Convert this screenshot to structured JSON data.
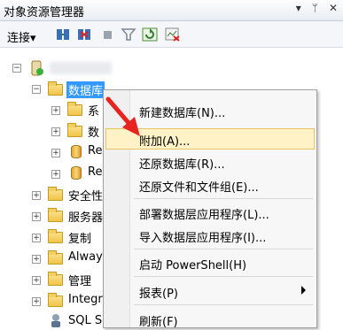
{
  "window": {
    "title": "对象资源管理器",
    "pin_glyph": "▾ ᛘ ✕"
  },
  "toolbar": {
    "connect_label": "连接",
    "connect_dropdown": "▾"
  },
  "tree": {
    "database_folder": "数据库",
    "children": [
      "系",
      "数",
      "Re",
      "Re"
    ],
    "items": [
      "安全性",
      "服务器",
      "复制",
      "Alway",
      "管理",
      "Integr",
      "SQL S"
    ]
  },
  "context_menu": {
    "items": [
      {
        "label": "新建数据库(N)...",
        "highlighted": false
      },
      {
        "label": "附加(A)...",
        "highlighted": true
      },
      {
        "label": "还原数据库(R)...",
        "highlighted": false
      },
      {
        "label": "还原文件和文件组(E)...",
        "highlighted": false
      },
      {
        "label": "部署数据层应用程序(L)...",
        "highlighted": false
      },
      {
        "label": "导入数据层应用程序(I)...",
        "highlighted": false
      },
      {
        "label": "启动 PowerShell(H)",
        "highlighted": false
      },
      {
        "label": "报表(P)",
        "highlighted": false,
        "submenu": true
      },
      {
        "label": "刷新(F)",
        "highlighted": false
      }
    ]
  },
  "colors": {
    "highlight_bg": "#fff2c6",
    "arrow": "#e8231f",
    "selected_node": "#3399ff"
  }
}
